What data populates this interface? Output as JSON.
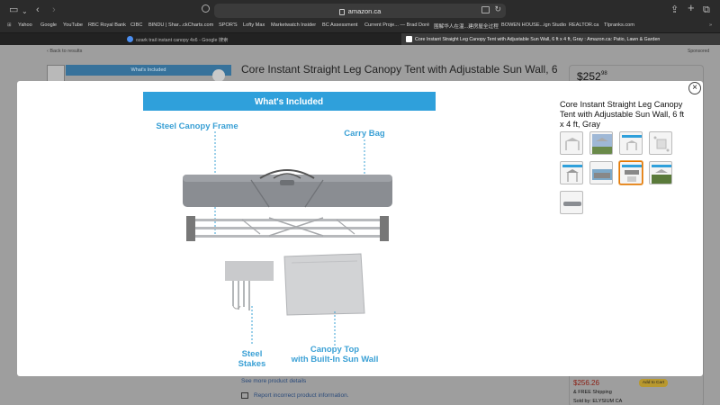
{
  "browser": {
    "url": "amazon.ca",
    "bookmarks": [
      "Yahoo",
      "Google",
      "YouTube",
      "RBC Royal Bank",
      "CIBC",
      "BINDU | Shar...ckCharts.com",
      "SPOR'S",
      "Lofty Max",
      "Marketwatch Insider",
      "BC Assessment",
      "Current Proje... — Brad Doré",
      "围解华人在温...建房屋全过程",
      "BOWEN HOUSE...ign Studio",
      "REALTOR.ca",
      "TIpranks.com"
    ],
    "tabs": [
      {
        "label": "ozark trail instant canopy 4x6 - Google 搜索",
        "active": false
      },
      {
        "label": "Core Instant Straight Leg Canopy Tent with Adjustable Sun Wall, 6 ft x 4 ft, Gray : Amazon.ca: Patio, Lawn & Garden",
        "active": true
      }
    ]
  },
  "page": {
    "back_link": "‹ Back to results",
    "sponsored": "Sponsored",
    "title": "Core Instant Straight Leg Canopy Tent with Adjustable Sun Wall, 6",
    "price_whole": "$252",
    "price_fraction": "98",
    "list_price": "$256.26",
    "shipping": "& FREE Shipping",
    "sold_by": "Sold by: ELYSIUM CA",
    "add_to_cart": "Add to Cart",
    "see_more": "See more product details",
    "report": "Report incorrect product information.",
    "whats_included_small": "What's Included"
  },
  "modal": {
    "title": "Core Instant Straight Leg Canopy Tent with Adjustable Sun Wall, 6 ft x 4 ft, Gray",
    "close_label": "×",
    "thumbnail_count": 9,
    "selected_thumbnail": 4,
    "image": {
      "banner": "What's Included",
      "labels": {
        "frame": "Steel Canopy Frame",
        "bag": "Carry Bag",
        "stakes_1": "Steel",
        "stakes_2": "Stakes",
        "canopy_1": "Canopy Top",
        "canopy_2": "with Built-In Sun Wall"
      }
    }
  },
  "colors": {
    "banner_blue": "#2fa0db",
    "callout_blue": "#3aa0d5",
    "selected_outline": "#e77600"
  }
}
